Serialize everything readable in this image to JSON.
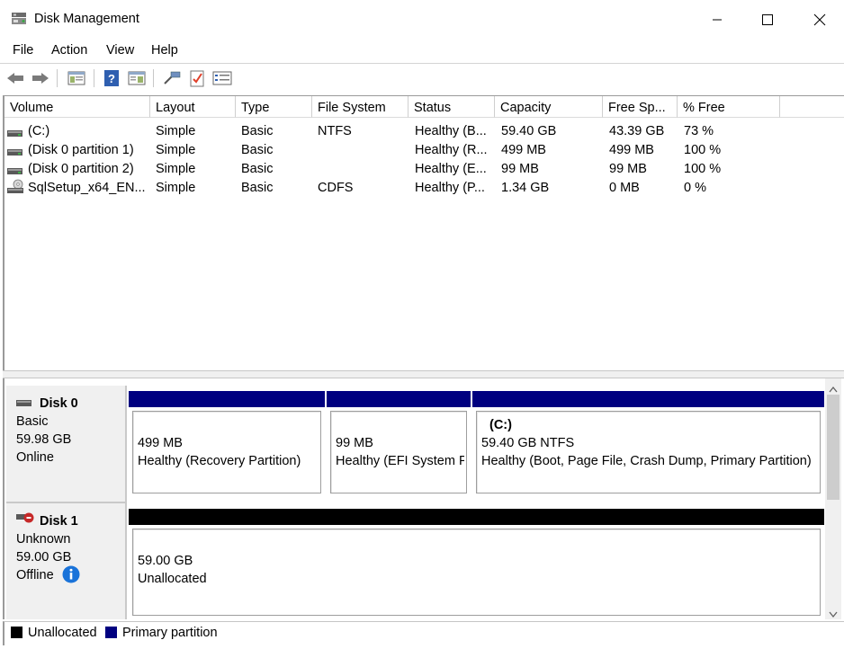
{
  "window": {
    "title": "Disk Management"
  },
  "menu": {
    "items": [
      "File",
      "Action",
      "View",
      "Help"
    ]
  },
  "columns": [
    "Volume",
    "Layout",
    "Type",
    "File System",
    "Status",
    "Capacity",
    "Free Sp...",
    "% Free"
  ],
  "volumes": [
    {
      "name": "(C:)",
      "layout": "Simple",
      "type": "Basic",
      "fs": "NTFS",
      "status": "Healthy (B...",
      "capacity": "59.40 GB",
      "free": "43.39 GB",
      "pct": "73 %",
      "icon": "drive-icon"
    },
    {
      "name": "(Disk 0 partition 1)",
      "layout": "Simple",
      "type": "Basic",
      "fs": "",
      "status": "Healthy (R...",
      "capacity": "499 MB",
      "free": "499 MB",
      "pct": "100 %",
      "icon": "drive-icon"
    },
    {
      "name": "(Disk 0 partition 2)",
      "layout": "Simple",
      "type": "Basic",
      "fs": "",
      "status": "Healthy (E...",
      "capacity": "99 MB",
      "free": "99 MB",
      "pct": "100 %",
      "icon": "drive-icon"
    },
    {
      "name": "SqlSetup_x64_EN...",
      "layout": "Simple",
      "type": "Basic",
      "fs": "CDFS",
      "status": "Healthy (P...",
      "capacity": "1.34 GB",
      "free": "0 MB",
      "pct": "0 %",
      "icon": "cd-drive-icon"
    }
  ],
  "disks": [
    {
      "name": "Disk 0",
      "kind": "Basic",
      "size": "59.98 GB",
      "state": "Online",
      "partitions": [
        {
          "size": "499 MB",
          "status": "Healthy (Recovery Partition)"
        },
        {
          "size": "99 MB",
          "status": "Healthy (EFI System P"
        },
        {
          "label": "(C:)",
          "size": "59.40 GB NTFS",
          "status": "Healthy (Boot, Page File, Crash Dump, Primary Partition)"
        }
      ]
    },
    {
      "name": "Disk 1",
      "kind": "Unknown",
      "size": "59.00 GB",
      "state": "Offline",
      "partitions": [
        {
          "size": "59.00 GB",
          "status": "Unallocated"
        }
      ]
    }
  ],
  "legend": [
    {
      "label": "Unallocated",
      "color": "#000000"
    },
    {
      "label": "Primary partition",
      "color": "#000080"
    }
  ],
  "colors": {
    "primary": "#000080",
    "unallocated": "#000000"
  }
}
